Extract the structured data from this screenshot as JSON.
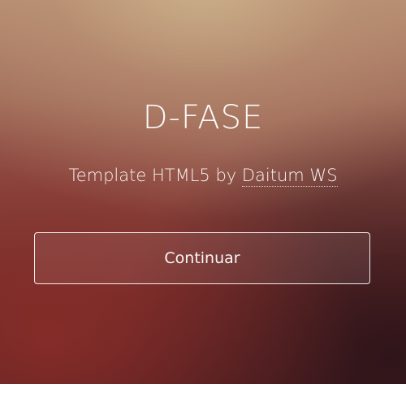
{
  "hero": {
    "title": "D-FASE",
    "subtitle_prefix": "Template HTML5 by ",
    "subtitle_link": "Daitum WS",
    "button_label": "Continuar"
  },
  "colors": {
    "text": "#ffffff",
    "gradient_top": "#b48a6e",
    "gradient_mid": "#8d4e45",
    "gradient_bottom": "#4a1e22"
  }
}
